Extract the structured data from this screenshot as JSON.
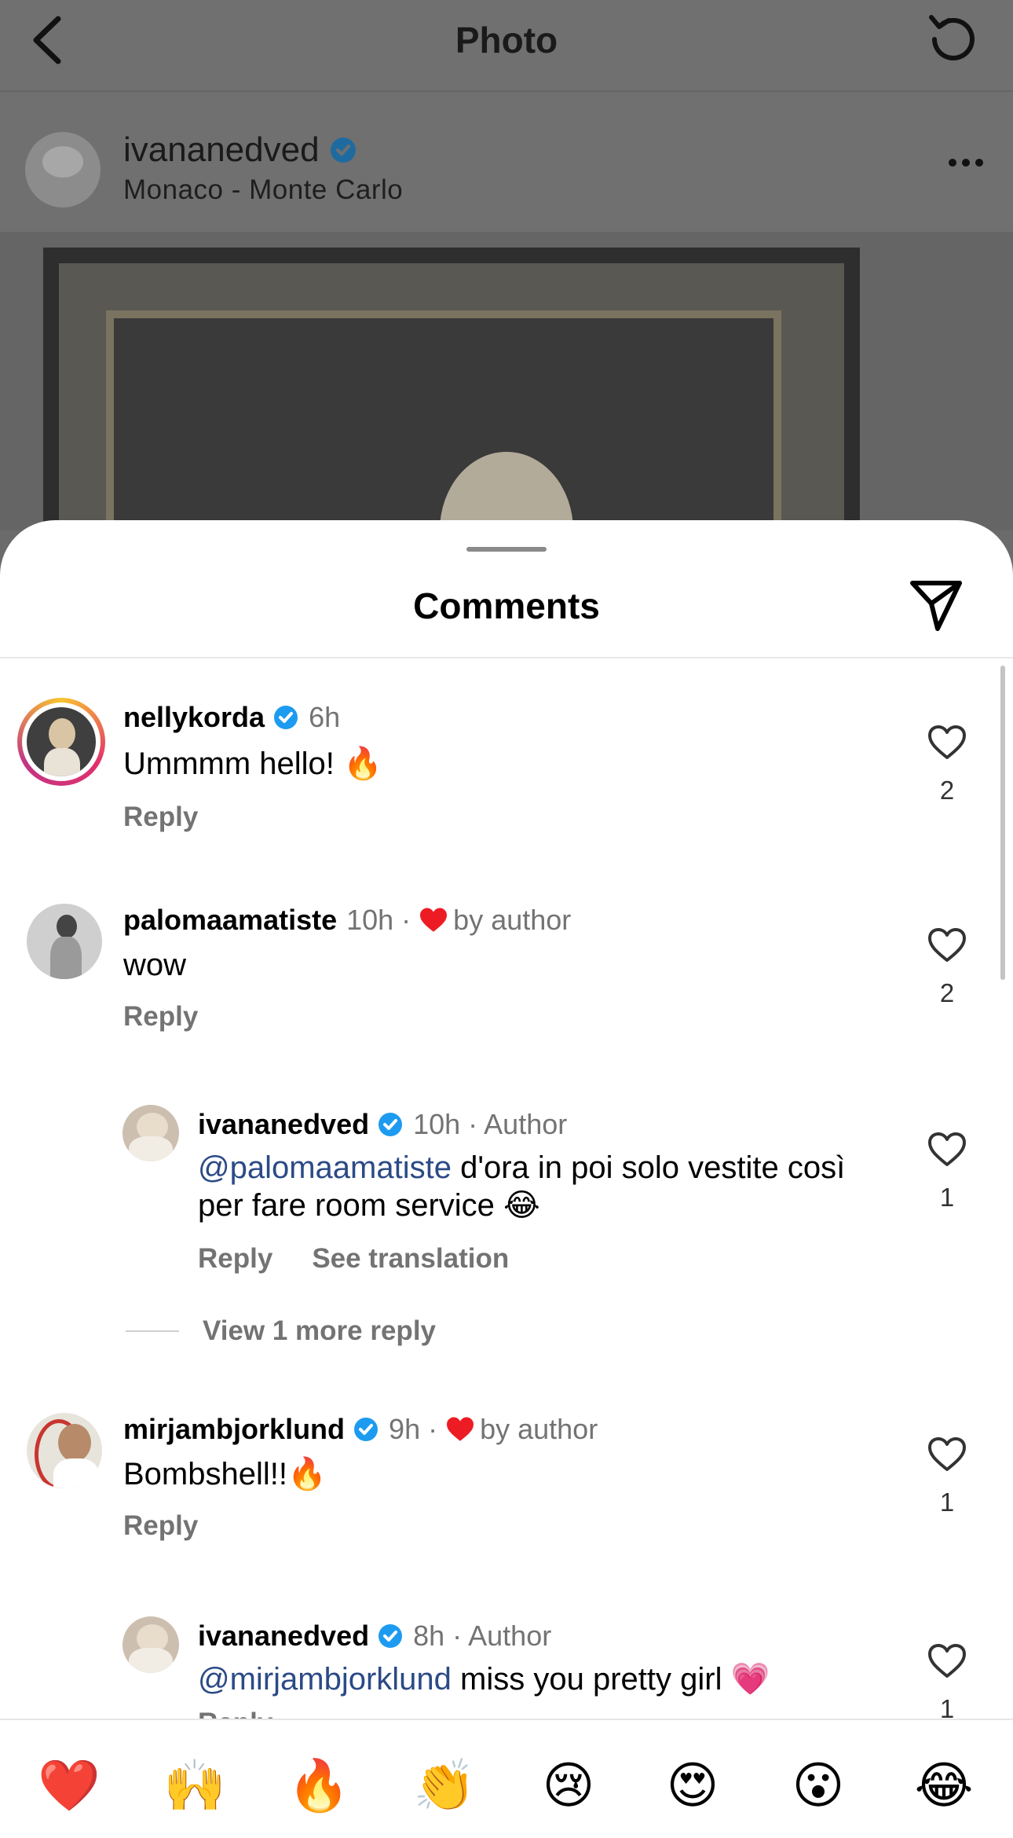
{
  "header": {
    "title": "Photo",
    "back_icon": "chevron-left-icon",
    "reload_icon": "reload-icon"
  },
  "post": {
    "username": "ivananedved",
    "location": "Monaco - Monte Carlo"
  },
  "sheet": {
    "title": "Comments"
  },
  "comments": [
    {
      "username": "nellykorda",
      "time": "6h",
      "text": "Ummmm hello! 🔥",
      "reply": "Reply",
      "likes": "2",
      "verified": true
    },
    {
      "username": "palomaamatiste",
      "time": "10h ·",
      "liked_by": "by author",
      "text": "wow",
      "reply": "Reply",
      "likes": "2",
      "verified": false
    },
    {
      "username": "ivananedved",
      "time": "10h · Author",
      "mention": "@palomaamatiste",
      "text": " d'ora in poi solo vestite così per fare room service 😂",
      "reply": "Reply",
      "translate": "See translation",
      "likes": "1",
      "verified": true
    },
    {
      "username": "mirjambjorklund",
      "time": "9h ·",
      "liked_by": "by author",
      "text": "Bombshell!!🔥",
      "reply": "Reply",
      "likes": "1",
      "verified": true
    },
    {
      "username": "ivananedved",
      "time": "8h · Author",
      "mention": "@mirjambjorklund",
      "text": " miss you pretty girl 💗",
      "reply": "Reply",
      "likes": "1",
      "verified": true
    }
  ],
  "view_more": "View 1 more reply",
  "emoji_bar": [
    "❤️",
    "🙌",
    "🔥",
    "👏",
    "😢",
    "😍",
    "😮",
    "😂"
  ],
  "colors": {
    "verified": "#1d9bf0",
    "like_heart": "#ed1c24",
    "mention": "#2b4a86",
    "meta": "#737373"
  }
}
